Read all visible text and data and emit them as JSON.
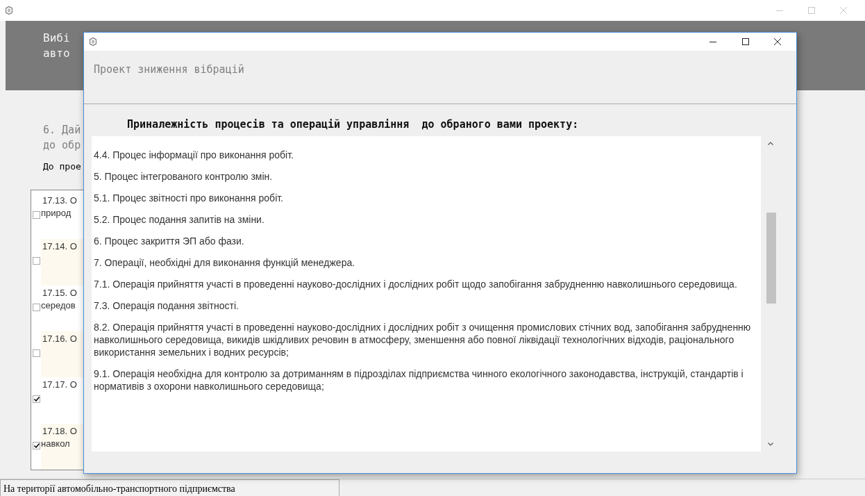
{
  "main_window": {
    "header_lines": [
      "Вибі",
      "авто"
    ],
    "question_lines": [
      "6. Дай",
      "до обр"
    ],
    "subheading": "До прое",
    "items": [
      {
        "lines": [
          "17.13. О",
          "природ"
        ],
        "checked": false,
        "shaded": false
      },
      {
        "lines": [
          "17.14. О"
        ],
        "checked": false,
        "shaded": true
      },
      {
        "lines": [
          "17.15. О",
          "середов"
        ],
        "checked": false,
        "shaded": false
      },
      {
        "lines": [
          "17.16. О"
        ],
        "checked": false,
        "shaded": true
      },
      {
        "lines": [
          "17.17. О"
        ],
        "checked": true,
        "shaded": false
      },
      {
        "lines": [
          "17.18. О",
          "навкол"
        ],
        "checked": true,
        "shaded": true
      }
    ],
    "status_bar": "На території автомобільно-транспортного підприємства"
  },
  "dialog": {
    "project": "Проект зниження вібрацій",
    "heading": "Приналежність процесів та операцій управління  до обраного вами проекту:",
    "paragraphs": [
      "4.4. Процес інформації про виконання робіт.",
      "5. Процес інтегрованого контролю змін.",
      "5.1. Процес звітності про виконання робіт.",
      "5.2. Процес подання запитів на зміни.",
      "6. Процес закриття ЭП або фази.",
      "7. Операції, необхідні для виконання функцій менеджера.",
      "7.1. Операція прийняття участі в проведенні науково-дослідних і дослідних робіт щодо запобігання забрудненню навколишнього середовища.",
      "7.3. Операція подання звітності.",
      "8.2.  Операція прийняття участі в проведенні науково-дослідних і дослідних робіт з очищення промислових стічних вод, запобігання забрудненню навколишнього середовища, викидів шкідливих речовин в атмосферу, зменшення або повної ліквідації технологічних відходів, раціонального використання земельних і водних ресурсів;",
      "9.1. Операція необхідна для контролю за дотриманням в підрозділах підприємства чинного екологічного законодавства, інструкцій, стандартів і нормативів з охорони навколишнього середовища;"
    ]
  }
}
